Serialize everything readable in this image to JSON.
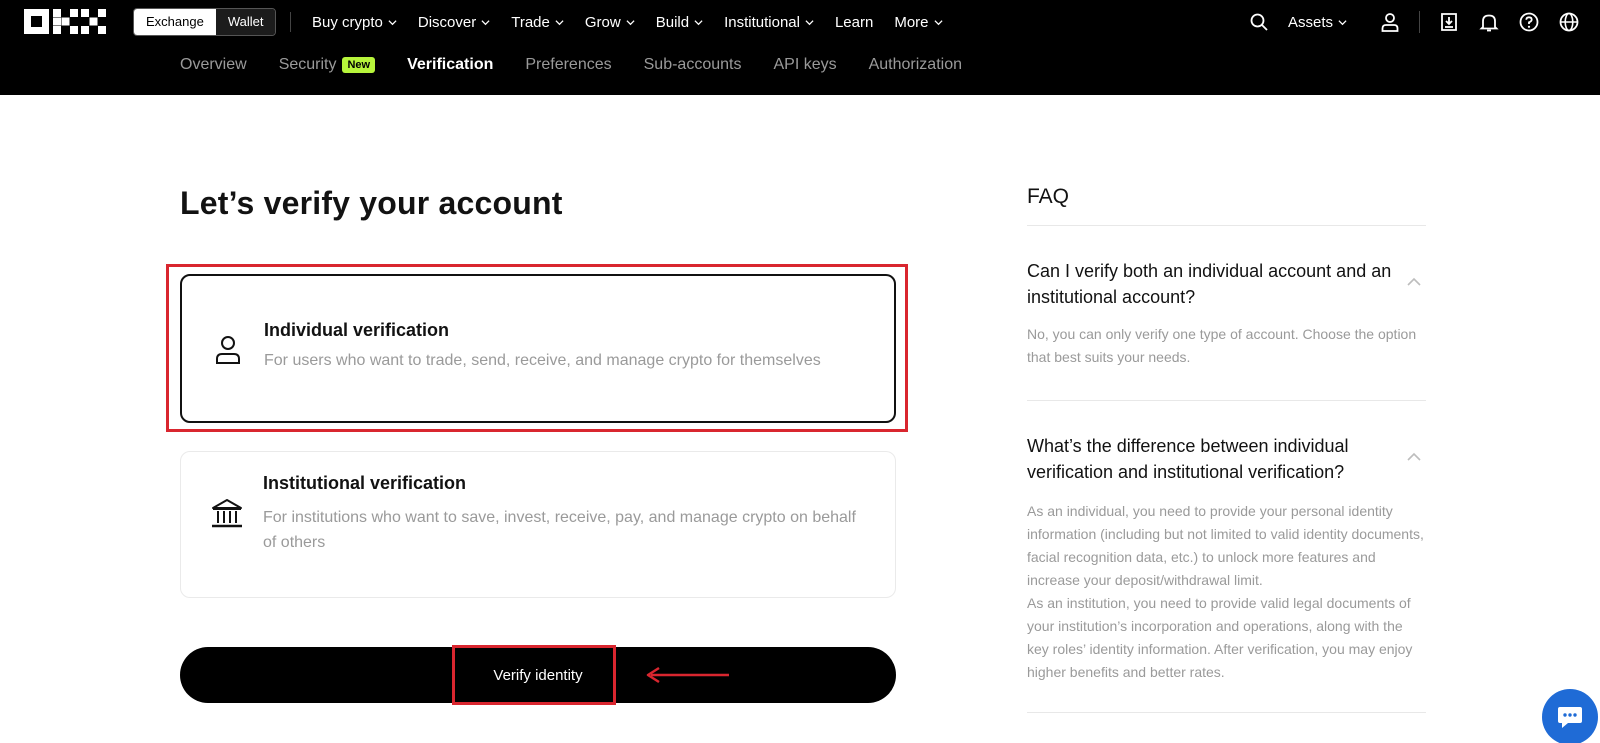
{
  "brand": {
    "name": "OKX"
  },
  "mode_switch": {
    "exchange": "Exchange",
    "wallet": "Wallet"
  },
  "nav": {
    "items": [
      {
        "label": "Buy crypto",
        "dropdown": true
      },
      {
        "label": "Discover",
        "dropdown": true
      },
      {
        "label": "Trade",
        "dropdown": true
      },
      {
        "label": "Grow",
        "dropdown": true
      },
      {
        "label": "Build",
        "dropdown": true
      },
      {
        "label": "Institutional",
        "dropdown": true
      },
      {
        "label": "Learn",
        "dropdown": false
      },
      {
        "label": "More",
        "dropdown": true
      }
    ],
    "assets": "Assets",
    "icons": [
      "search-icon",
      "user-icon",
      "download-icon",
      "bell-icon",
      "help-icon",
      "globe-icon"
    ]
  },
  "subnav": {
    "items": [
      "Overview",
      "Security",
      "Verification",
      "Preferences",
      "Sub-accounts",
      "API keys",
      "Authorization"
    ],
    "active": "Verification",
    "new_badge": "New"
  },
  "main": {
    "title": "Let’s verify your account",
    "options": [
      {
        "title": "Individual verification",
        "desc": "For users who want to trade, send, receive, and manage crypto for themselves",
        "icon": "person-icon",
        "selected": true
      },
      {
        "title": "Institutional verification",
        "desc": "For institutions who want to save, invest, receive, pay, and manage crypto on behalf of others",
        "icon": "bank-icon",
        "selected": false
      }
    ],
    "verify_button": "Verify identity"
  },
  "faq": {
    "title": "FAQ",
    "items": [
      {
        "q": "Can I verify both an individual account and an institutional account?",
        "a": "No, you can only verify one type of account. Choose the option that best suits your needs."
      },
      {
        "q": "What’s the difference between individual verification and institutional verification?",
        "a": "As an individual, you need to provide your personal identity information (including but not limited to valid identity documents, facial recognition data, etc.) to unlock more features and increase your deposit/withdrawal limit.\nAs an institution, you need to provide valid legal documents of your institution’s incorporation and operations, along with the key roles’ identity information. After verification, you may enjoy higher benefits and better rates."
      }
    ]
  },
  "colors": {
    "annotation": "#d9262f",
    "new_badge": "#b7f53b",
    "chat": "#1f6bd6"
  }
}
